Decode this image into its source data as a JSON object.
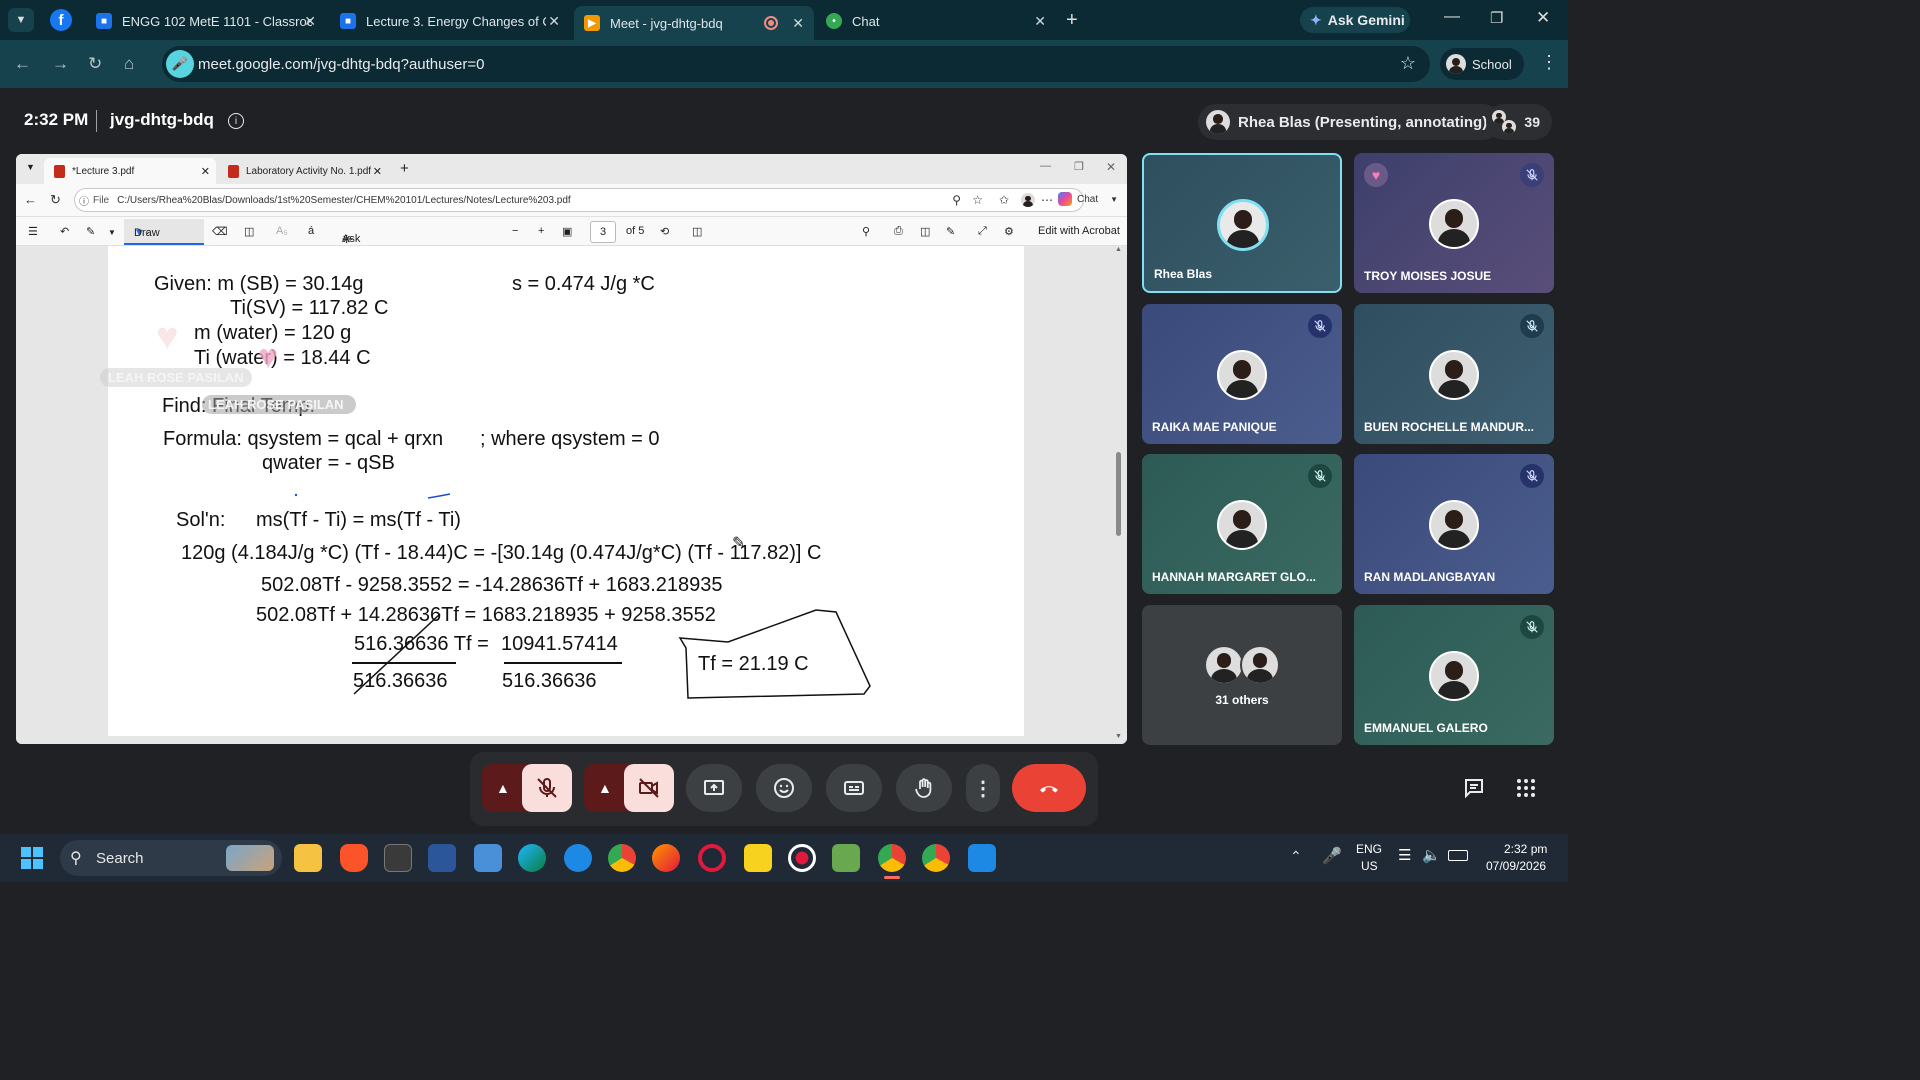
{
  "browser": {
    "tabs": [
      {
        "title": "ENGG 102 MetE 1101 - Classroom",
        "icon": "classroom-icon"
      },
      {
        "title": "Lecture 3. Energy Changes of Chemical",
        "icon": "classroom-icon"
      },
      {
        "title": "Meet - jvg-dhtg-bdq",
        "icon": "meet-icon"
      },
      {
        "title": "Chat",
        "icon": "chat-icon"
      }
    ],
    "gemini_label": "Ask Gemini",
    "url": "meet.google.com/jvg-dhtg-bdq?authuser=0",
    "profile_label": "School"
  },
  "meet": {
    "time": "2:32 PM",
    "meeting_code": "jvg-dhtg-bdq",
    "presenter_label": "Rhea Blas (Presenting, annotating)",
    "participant_count": "39"
  },
  "pdf_window": {
    "tabs": [
      "*Lecture 3.pdf",
      "Laboratory Activity No. 1.pdf"
    ],
    "file_label": "File",
    "path": "C:/Users/Rhea%20Blas/Downloads/1st%20Semester/CHEM%20101/Lectures/Notes/Lecture%203.pdf",
    "chat_label": "Chat",
    "toolbar": {
      "draw_label": "Draw",
      "copilot_label": "Ask Copilot",
      "page_number": "3",
      "page_total": "of 5",
      "acrobat_label": "Edit with Acrobat"
    }
  },
  "notes": {
    "given_label": "Given: m (SB) = 30.14g",
    "s_value": "s = 0.474 J/g *C",
    "ti_sv": "Ti(SV) = 117.82 C",
    "m_water": "m (water) = 120 g",
    "ti_water": "Ti (water) = 18.44 C",
    "find": "Find: Final Temp.",
    "formula": "Formula: qsystem = qcal + qrxn",
    "where": "; where qsystem = 0",
    "qwater": "qwater = - qSB",
    "soln_label": "Sol'n:",
    "soln_eq": "ms(Tf - Ti) = ms(Tf - Ti)",
    "line1": "120g (4.184J/g *C) (Tf - 18.44)C = -[30.14g (0.474J/g*C) (Tf - 117.82)] C",
    "line2": "502.08Tf  - 9258.3552  =  -14.28636Tf + 1683.218935",
    "line3": "502.08Tf + 14.28636Tf = 1683.218935 + 9258.3552",
    "line4_left": "516.36636 Tf =",
    "line4_right": "10941.57414",
    "den_left": "516.36636",
    "den_right": "516.36636",
    "answer": "Tf = 21.19 C",
    "overlay_name1": "LEAH ROSE PASILAN",
    "overlay_name2": "LEAH ROSE PASILAN"
  },
  "participants": [
    {
      "name": "Rhea Blas",
      "muted": false,
      "speaking": true
    },
    {
      "name": "TROY MOISES JOSUE",
      "muted": true
    },
    {
      "name": "RAIKA MAE PANIQUE",
      "muted": true
    },
    {
      "name": "BUEN ROCHELLE MANDUR...",
      "muted": true
    },
    {
      "name": "HANNAH MARGARET GLO...",
      "muted": true
    },
    {
      "name": "RAN MADLANGBAYAN",
      "muted": true
    },
    {
      "name": "31 others",
      "muted": false
    },
    {
      "name": "EMMANUEL GALERO",
      "muted": true
    }
  ],
  "taskbar": {
    "search_label": "Search",
    "lang_top": "ENG",
    "lang_bottom": "US",
    "time": "2:32 pm",
    "date": "07/09/2026"
  }
}
